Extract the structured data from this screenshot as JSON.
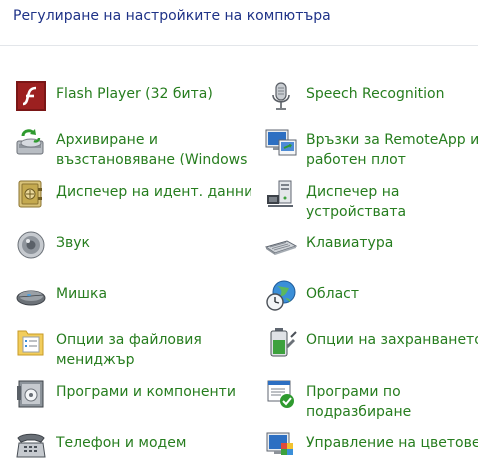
{
  "header": {
    "title": "Регулиране на настройките на компютъра"
  },
  "items": [
    {
      "id": "flash-player",
      "label1": "Flash Player (32 бита)",
      "label2": "",
      "icon": "flash-player-icon"
    },
    {
      "id": "speech-recognition",
      "label1": "Speech Recognition",
      "label2": "",
      "icon": "microphone-icon"
    },
    {
      "id": "backup-restore",
      "label1": "Архивиране и",
      "label2": "възстановяване (Windows",
      "icon": "backup-restore-icon"
    },
    {
      "id": "remoteapp",
      "label1": "Връзки за RemoteApp и",
      "label2": "работен плот",
      "icon": "remote-desktop-icon"
    },
    {
      "id": "credential-manager",
      "label1": "Диспечер на идент. данни",
      "label2": "",
      "icon": "credential-vault-icon"
    },
    {
      "id": "device-manager",
      "label1": "Диспечер на",
      "label2": "устройствата",
      "icon": "device-manager-icon"
    },
    {
      "id": "sound",
      "label1": "Звук",
      "label2": "",
      "icon": "speaker-icon"
    },
    {
      "id": "keyboard",
      "label1": "Клавиатура",
      "label2": "",
      "icon": "keyboard-icon"
    },
    {
      "id": "mouse",
      "label1": "Мишка",
      "label2": "",
      "icon": "mouse-icon"
    },
    {
      "id": "region",
      "label1": "Област",
      "label2": "",
      "icon": "globe-clock-icon"
    },
    {
      "id": "file-explorer-options",
      "label1": "Опции за файловия",
      "label2": "мениджър",
      "icon": "folder-options-icon"
    },
    {
      "id": "power-options",
      "label1": "Опции на захранването",
      "label2": "",
      "icon": "battery-icon"
    },
    {
      "id": "programs-features",
      "label1": "Програми и компоненти",
      "label2": "",
      "icon": "programs-icon"
    },
    {
      "id": "default-programs",
      "label1": "Програми по",
      "label2": "подразбиране",
      "icon": "default-programs-icon"
    },
    {
      "id": "phone-modem",
      "label1": "Телефон и модем",
      "label2": "",
      "icon": "telephone-icon"
    },
    {
      "id": "color-management",
      "label1": "Управление на цветовете",
      "label2": "",
      "icon": "color-management-icon"
    }
  ]
}
